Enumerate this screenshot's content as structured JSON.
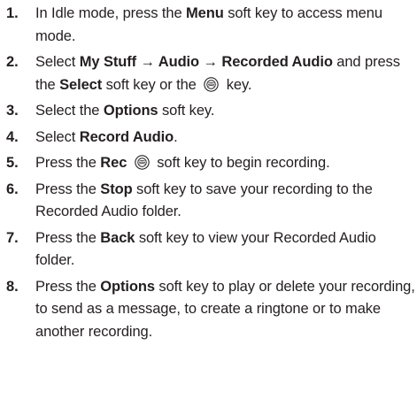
{
  "steps": [
    {
      "num": "1.",
      "parts": [
        {
          "t": "In Idle mode, press the "
        },
        {
          "t": "Menu",
          "b": true
        },
        {
          "t": " soft key to access menu mode."
        }
      ]
    },
    {
      "num": "2.",
      "parts": [
        {
          "t": "Select "
        },
        {
          "t": "My Stuff → Audio → Recorded Audio",
          "b": true
        },
        {
          "t": " and press the "
        },
        {
          "t": "Select",
          "b": true
        },
        {
          "t": " soft key or the "
        },
        {
          "icon": "ok-key-icon"
        },
        {
          "t": " key."
        }
      ]
    },
    {
      "num": "3.",
      "parts": [
        {
          "t": "Select the "
        },
        {
          "t": "Options",
          "b": true
        },
        {
          "t": " soft key."
        }
      ]
    },
    {
      "num": "4.",
      "parts": [
        {
          "t": "Select "
        },
        {
          "t": "Record Audio",
          "b": true
        },
        {
          "t": "."
        }
      ]
    },
    {
      "num": "5.",
      "parts": [
        {
          "t": "Press the "
        },
        {
          "t": "Rec",
          "b": true
        },
        {
          "t": " "
        },
        {
          "icon": "ok-key-icon"
        },
        {
          "t": " soft key to begin recording."
        }
      ]
    },
    {
      "num": "6.",
      "parts": [
        {
          "t": "Press the "
        },
        {
          "t": "Stop",
          "b": true
        },
        {
          "t": " soft key to save your recording to the Recorded Audio folder."
        }
      ]
    },
    {
      "num": "7.",
      "parts": [
        {
          "t": "Press the "
        },
        {
          "t": "Back",
          "b": true
        },
        {
          "t": " soft key to view your Recorded Audio folder."
        }
      ]
    },
    {
      "num": "8.",
      "parts": [
        {
          "t": "Press the "
        },
        {
          "t": "Options",
          "b": true
        },
        {
          "t": " soft key to play or delete your recording, to send as a message, to create a ringtone or to make another recording."
        }
      ]
    }
  ]
}
